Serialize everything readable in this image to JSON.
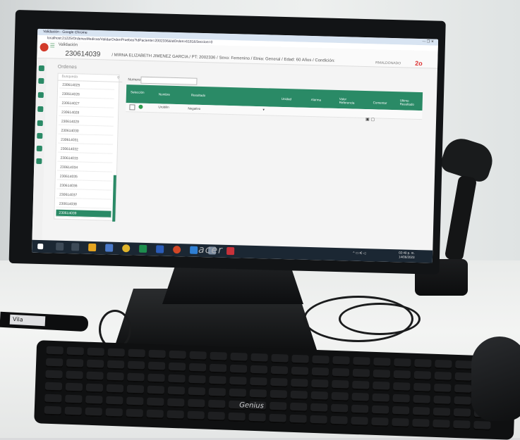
{
  "browser": {
    "window_title": "Validación - Google Chrome",
    "url": "localhost:21225/OrdenesMedicas/ValidarOrdenPruebas?IdPaciente=2002336&IdOrden=6181&Seccion=0",
    "window_controls": "— ❐ ✕"
  },
  "app": {
    "menu_icon": "☰",
    "title": "Validación",
    "order_number": "230614039",
    "patient_line": "/ MIRNA ELIZABETH JIMENEZ GARCIA / PT: 2002336 / Sexo: Femenino / Etnia: General / Edad: 60 Años / Condición:",
    "user": "RMALDONADO",
    "user_icon": "2o"
  },
  "orders": {
    "heading": "Ordenes",
    "search_placeholder": "Busqueda",
    "items": [
      "230614025",
      "230614026",
      "230614027",
      "230614028",
      "230614029",
      "230614030",
      "230614031",
      "230614032",
      "230614033",
      "230614034",
      "230614035",
      "230614036",
      "230614037",
      "230614038",
      "230614039"
    ]
  },
  "filter": {
    "label": "Numero:",
    "value": ""
  },
  "table": {
    "headers": [
      "Selección",
      "Nombre",
      "Resultado",
      "Unidad",
      "Alarma",
      "Valor Referencia",
      "Comentar",
      "Ultimo Resultado"
    ],
    "rows": [
      {
        "name": "Urobilin",
        "result": "Negativo",
        "dropdown": "▾",
        "icons": "▣ ▢"
      }
    ]
  },
  "taskbar": {
    "tray": "^ ▭ ⑆ ◁",
    "time": "02:40 p. m.",
    "date": "14/06/2023"
  },
  "hardware": {
    "monitor_brand": "acer",
    "keyboard_brand": "Genius",
    "marker_label": "Vila"
  }
}
